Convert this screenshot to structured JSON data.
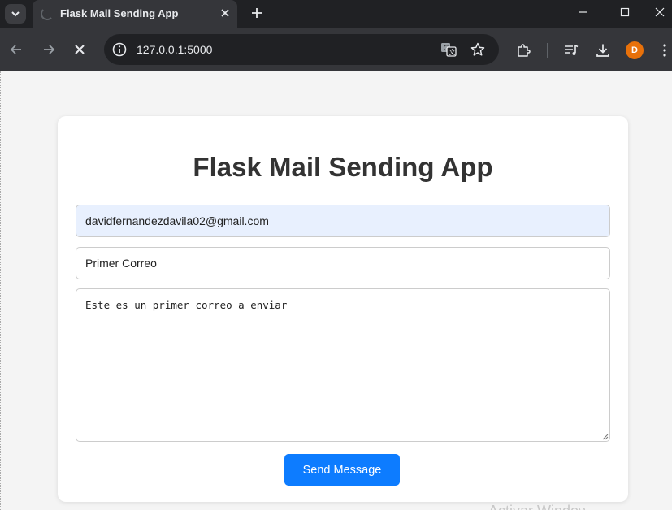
{
  "browser": {
    "tab_title": "Flask Mail Sending App",
    "url": "127.0.0.1:5000",
    "profile_initial": "D",
    "icons": {
      "tab_menu": "chevron-down-icon",
      "tab_loading": "loading-spinner-icon",
      "tab_close": "close-icon",
      "new_tab": "plus-icon",
      "minimize": "minimize-icon",
      "maximize": "maximize-icon",
      "close_window": "close-icon",
      "back": "arrow-left-icon",
      "forward": "arrow-right-icon",
      "stop": "close-icon",
      "site_info": "info-icon",
      "translate": "translate-icon",
      "bookmark": "star-icon",
      "extensions": "puzzle-icon",
      "media": "queue-music-icon",
      "downloads": "download-icon",
      "menu": "kebab-menu-icon"
    },
    "colors": {
      "titlebar": "#202124",
      "toolbar": "#35363a",
      "avatar": "#e8710a"
    }
  },
  "page": {
    "heading": "Flask Mail Sending App",
    "form": {
      "recipient_value": "davidfernandezdavila02@gmail.com",
      "subject_value": "Primer Correo",
      "message_value": "Este es un primer correo a enviar",
      "submit_label": "Send Message"
    },
    "colors": {
      "button": "#0d7cff",
      "autofill": "#e8f0fe",
      "heading": "#333333"
    }
  },
  "watermark": "Activar Windows"
}
